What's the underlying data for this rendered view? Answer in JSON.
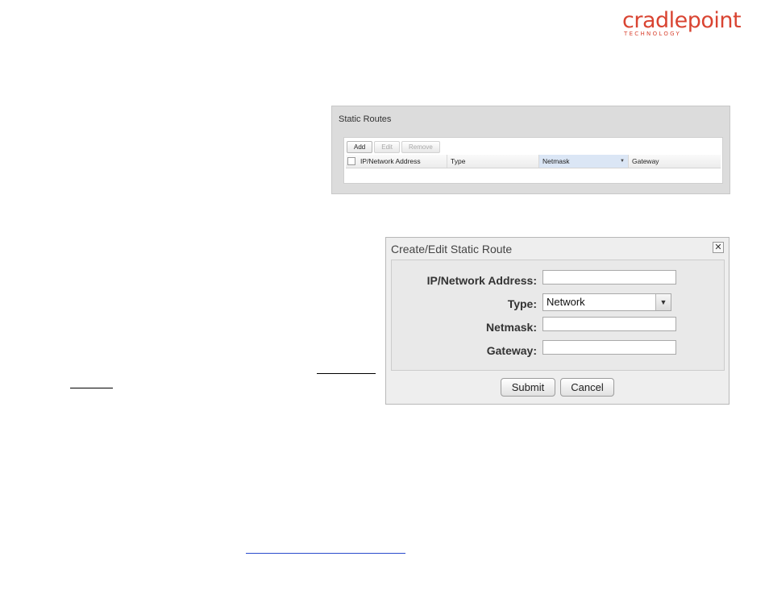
{
  "logo": {
    "main": "cradlepoint",
    "sub": "TECHNOLOGY",
    "color": "#d94432"
  },
  "static_routes": {
    "title": "Static Routes",
    "toolbar": [
      {
        "label": "Add",
        "enabled": true
      },
      {
        "label": "Edit",
        "enabled": false
      },
      {
        "label": "Remove",
        "enabled": false
      }
    ],
    "columns": [
      "IP/Network Address",
      "Type",
      "Netmask",
      "Gateway"
    ],
    "sorted_column": "Netmask",
    "rows": []
  },
  "dialog": {
    "title": "Create/Edit Static Route",
    "close_icon": "close-icon",
    "fields": {
      "ip_label": "IP/Network Address:",
      "ip_value": "",
      "type_label": "Type:",
      "type_value": "Network",
      "netmask_label": "Netmask:",
      "netmask_value": "",
      "gateway_label": "Gateway:",
      "gateway_value": ""
    },
    "submit_label": "Submit",
    "cancel_label": "Cancel"
  }
}
